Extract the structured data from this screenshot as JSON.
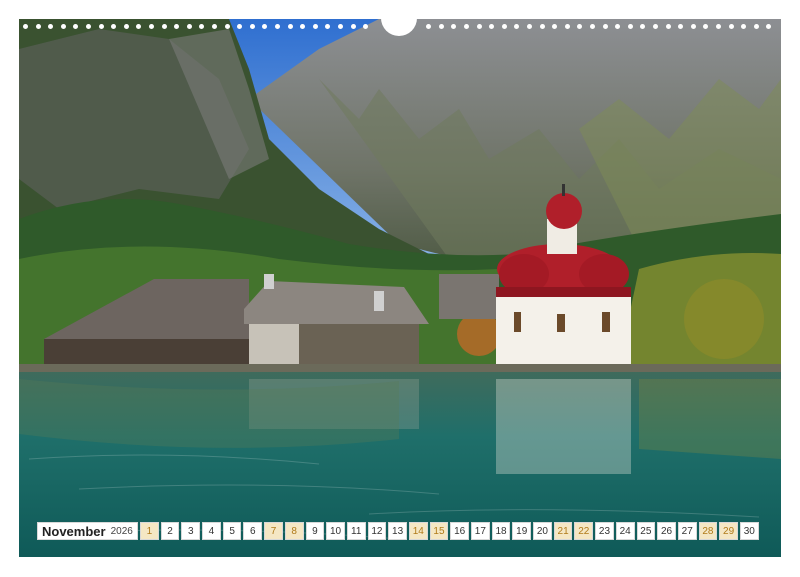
{
  "calendar": {
    "month": "November",
    "year": "2026",
    "days": [
      "1",
      "2",
      "3",
      "4",
      "5",
      "6",
      "7",
      "8",
      "9",
      "10",
      "11",
      "12",
      "13",
      "14",
      "15",
      "16",
      "17",
      "18",
      "19",
      "20",
      "21",
      "22",
      "23",
      "24",
      "25",
      "26",
      "27",
      "28",
      "29",
      "30"
    ],
    "weekend_days": [
      1,
      7,
      8,
      14,
      15,
      21,
      22,
      28,
      29
    ]
  },
  "colors": {
    "water": "#1f6f6a",
    "sky": "#3f7fd6",
    "roof_red": "#b01f2a",
    "forest": "#2f5a2a"
  }
}
